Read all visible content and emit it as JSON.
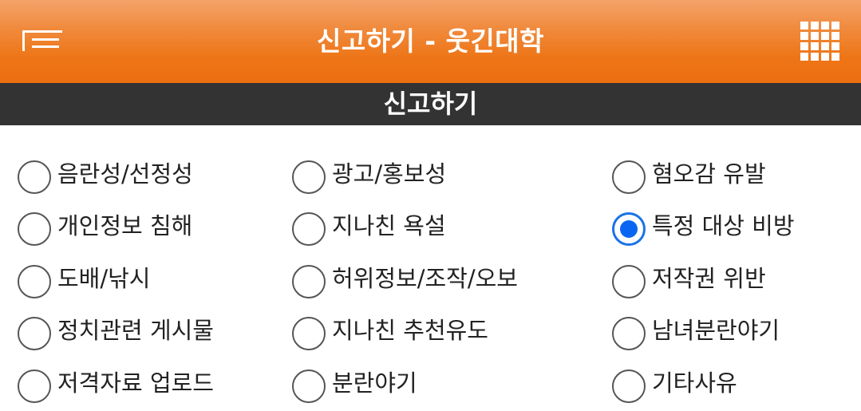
{
  "header": {
    "title": "신고하기 - 웃긴대학",
    "menu_icon": "menu-icon",
    "apps_icon": "grid-icon",
    "accent_color": "#ee7517"
  },
  "section": {
    "title": "신고하기"
  },
  "report_reasons": [
    {
      "label": "음란성/선정성",
      "checked": false
    },
    {
      "label": "광고/홍보성",
      "checked": false
    },
    {
      "label": "혐오감 유발",
      "checked": false
    },
    {
      "label": "개인정보 침해",
      "checked": false
    },
    {
      "label": "지나친 욕설",
      "checked": false
    },
    {
      "label": "특정 대상 비방",
      "checked": true
    },
    {
      "label": "도배/낚시",
      "checked": false
    },
    {
      "label": "허위정보/조작/오보",
      "checked": false
    },
    {
      "label": "저작권 위반",
      "checked": false
    },
    {
      "label": "정치관련 게시물",
      "checked": false
    },
    {
      "label": "지나친 추천유도",
      "checked": false
    },
    {
      "label": "남녀분란야기",
      "checked": false
    },
    {
      "label": "저격자료 업로드",
      "checked": false
    },
    {
      "label": "분란야기",
      "checked": false
    },
    {
      "label": "기타사유",
      "checked": false
    }
  ],
  "selected_color": "#0a66f2"
}
